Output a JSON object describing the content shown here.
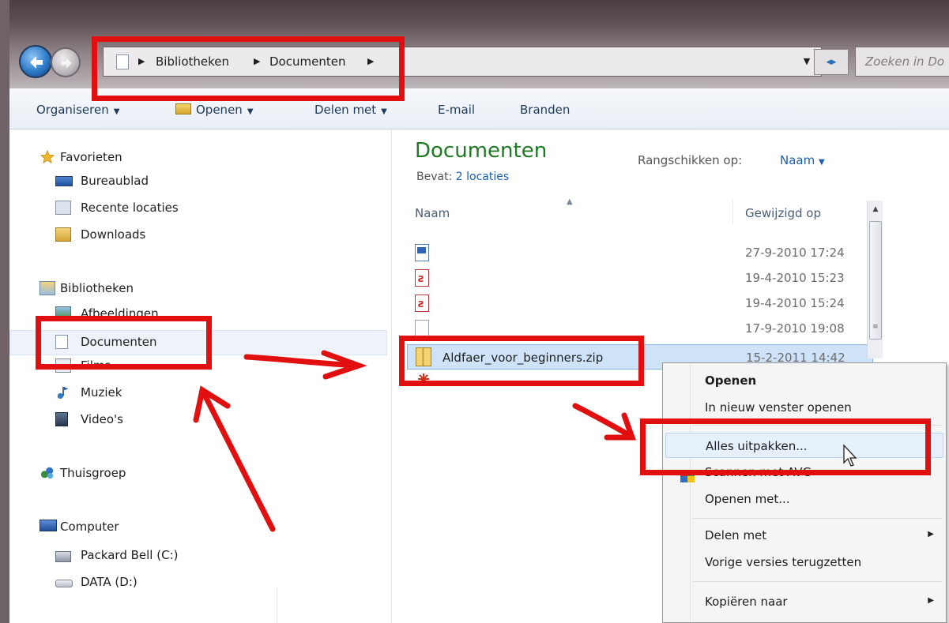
{
  "address_bar": {
    "crumbs": [
      "Bibliotheken",
      "Documenten"
    ],
    "search_placeholder": "Zoeken in Do"
  },
  "toolbar": {
    "organize": "Organiseren",
    "open": "Openen",
    "share": "Delen met",
    "email": "E-mail",
    "burn": "Branden"
  },
  "sidebar": {
    "favorites": "Favorieten",
    "desktop": "Bureaublad",
    "recent": "Recente locaties",
    "downloads": "Downloads",
    "libraries": "Bibliotheken",
    "pictures": "Afbeeldingen",
    "documents": "Documenten",
    "films": "Films",
    "music": "Muziek",
    "videos": "Video's",
    "homegroup": "Thuisgroep",
    "computer": "Computer",
    "drive_c": "Packard Bell (C:)",
    "drive_d": "DATA (D:)"
  },
  "content": {
    "title": "Documenten",
    "subtitle_prefix": "Bevat:",
    "subtitle_link": "2 locaties",
    "sort_label": "Rangschikken op:",
    "sort_value": "Naam",
    "col_name": "Naam",
    "col_modified": "Gewijzigd op",
    "files": [
      {
        "name": "",
        "date": "27-9-2010 17:24",
        "icon": "word-doc-icon"
      },
      {
        "name": "",
        "date": "19-4-2010 15:23",
        "icon": "pdf-icon"
      },
      {
        "name": "",
        "date": "19-4-2010 15:24",
        "icon": "pdf-icon"
      },
      {
        "name": "",
        "date": "17-9-2010 19:08",
        "icon": "blank-file-icon"
      },
      {
        "name": "Aldfaer_voor_beginners.zip",
        "date": "15-2-2011 14:42",
        "icon": "zip-folder-icon"
      }
    ]
  },
  "context_menu": {
    "open": "Openen",
    "open_new_window": "In nieuw venster openen",
    "extract_all": "Alles uitpakken...",
    "scan": "Scannen met AVG",
    "open_with": "Openen met...",
    "share_with": "Delen met",
    "restore": "Vorige versies terugzetten",
    "copy_to": "Kopiëren naar"
  },
  "colors": {
    "annotation_red": "#e10f0f",
    "library_title_green": "#1e7a23",
    "link_blue": "#1c5fb0",
    "selection_blue": "#cfe3f8"
  }
}
